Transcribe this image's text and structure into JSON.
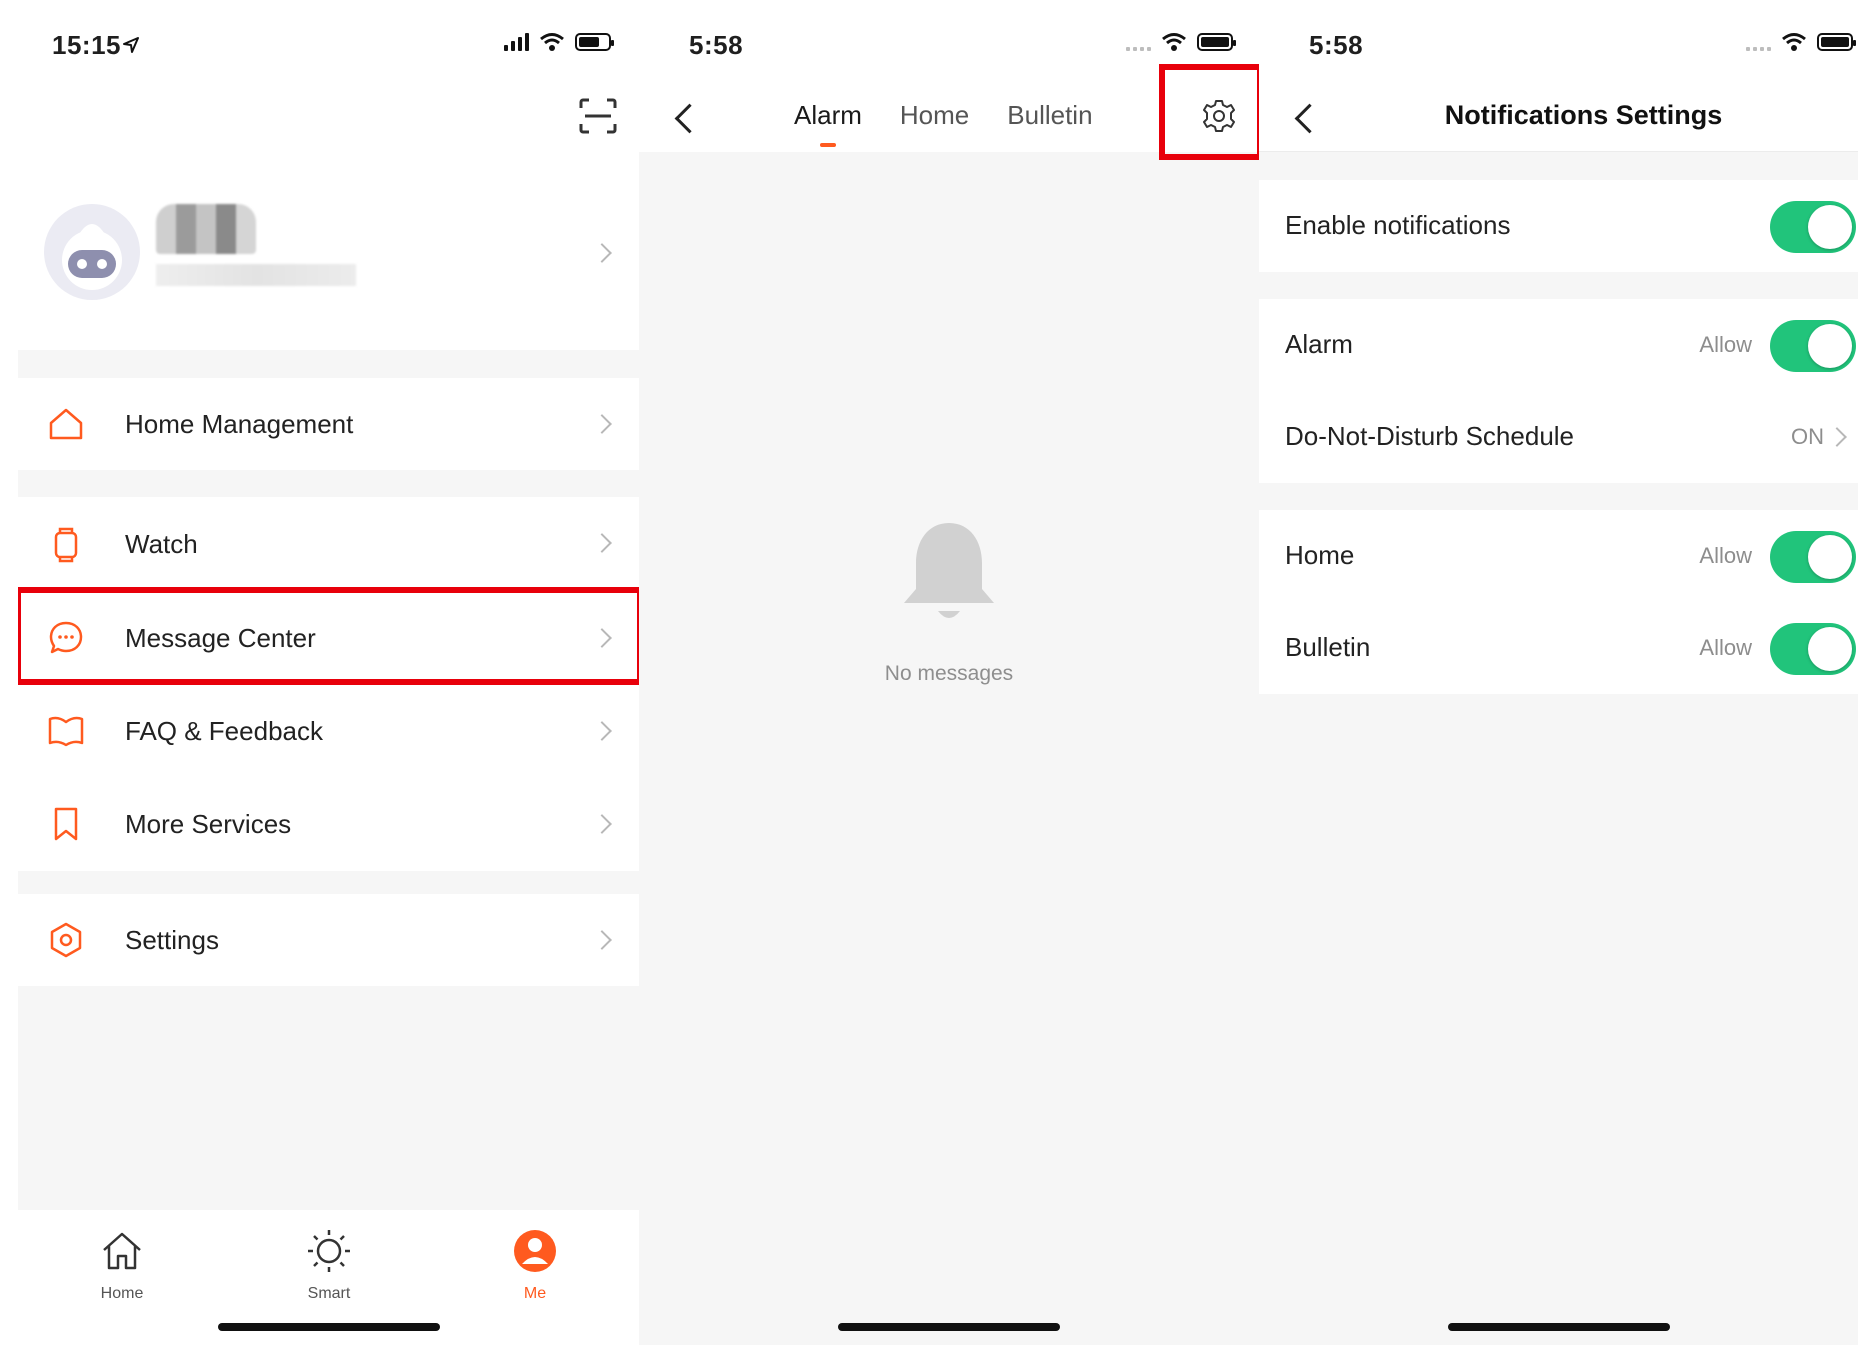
{
  "panel1": {
    "status_time": "15:15",
    "menu_groups": [
      [
        "Home Management"
      ],
      [
        "Watch",
        "Message Center",
        "FAQ & Feedback",
        "More Services"
      ],
      [
        "Settings"
      ]
    ],
    "tabbar": {
      "home": "Home",
      "smart": "Smart",
      "me": "Me"
    }
  },
  "panel2": {
    "status_time": "5:58",
    "tabs": [
      "Alarm",
      "Home",
      "Bulletin"
    ],
    "active_tab": "Alarm",
    "empty_message": "No messages"
  },
  "panel3": {
    "status_time": "5:58",
    "title": "Notifications Settings",
    "enable_notifications": "Enable notifications",
    "alarm": {
      "label": "Alarm",
      "value": "Allow"
    },
    "dnd": {
      "label": "Do-Not-Disturb Schedule",
      "value": "ON"
    },
    "home": {
      "label": "Home",
      "value": "Allow"
    },
    "bulletin": {
      "label": "Bulletin",
      "value": "Allow"
    }
  },
  "colors": {
    "accent": "#ff5a1f",
    "toggle_on": "#21c47b",
    "highlight": "#e8000b"
  }
}
